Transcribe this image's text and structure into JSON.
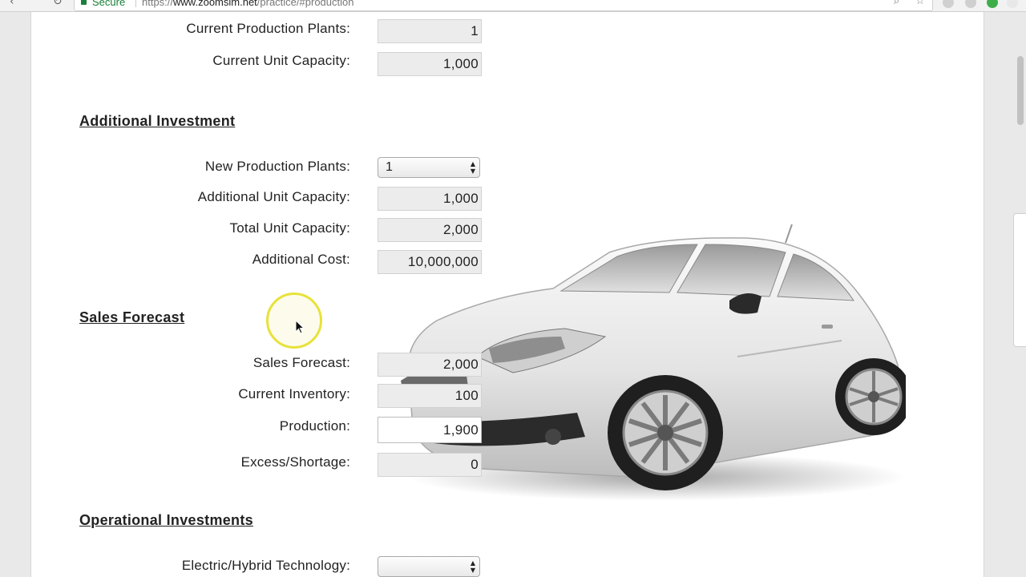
{
  "browser": {
    "secure_label": "Secure",
    "url_scheme": "https://",
    "url_domain": "www.zoomsim.net",
    "url_path": "/practice/#production"
  },
  "current": {
    "plants_label": "Current Production Plants:",
    "plants_value": "1",
    "capacity_label": "Current Unit Capacity:",
    "capacity_value": "1,000"
  },
  "additional_investment": {
    "title": "Additional Investment",
    "new_plants_label": "New Production Plants:",
    "new_plants_selected": "1",
    "additional_capacity_label": "Additional Unit Capacity:",
    "additional_capacity_value": "1,000",
    "total_capacity_label": "Total Unit Capacity:",
    "total_capacity_value": "2,000",
    "additional_cost_label": "Additional Cost:",
    "additional_cost_value": "10,000,000"
  },
  "sales_forecast": {
    "title": "Sales Forecast",
    "forecast_label": "Sales Forecast:",
    "forecast_value": "2,000",
    "inventory_label": "Current Inventory:",
    "inventory_value": "100",
    "production_label": "Production:",
    "production_value": "1,900",
    "excess_label": "Excess/Shortage:",
    "excess_value": "0"
  },
  "operational_investments": {
    "title": "Operational Investments",
    "hybrid_label": "Electric/Hybrid Technology:",
    "hybrid_selected": ""
  },
  "colors": {
    "secure_green": "#188038",
    "cursor_highlight": "#e7e23a",
    "readonly_field": "#ececec"
  },
  "icons": {
    "back": "back-arrow-icon",
    "reload": "reload-icon",
    "search": "search-icon",
    "bookmark": "star-icon",
    "car": "car-image"
  }
}
